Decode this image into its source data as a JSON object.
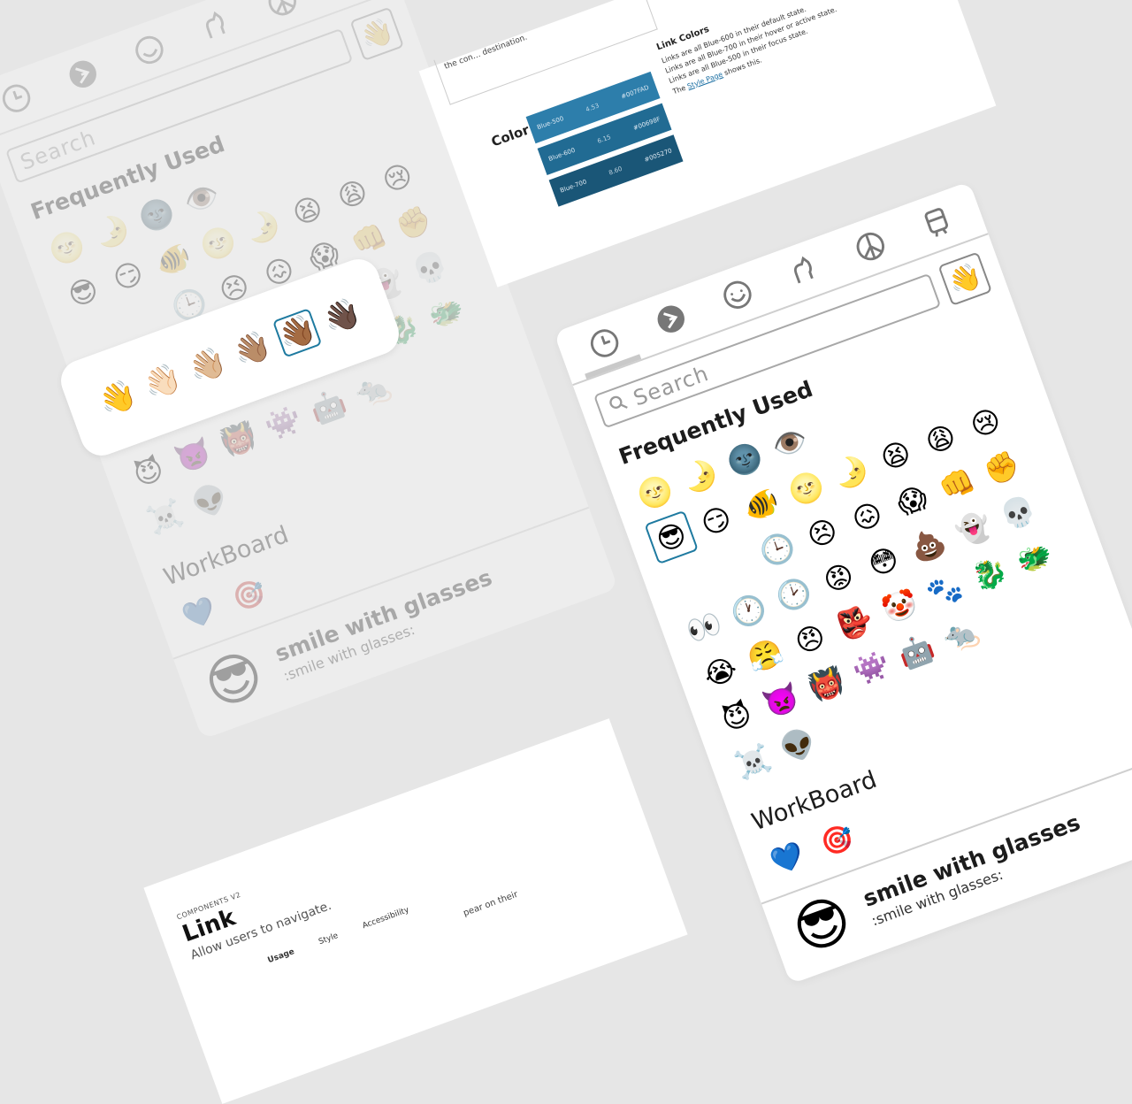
{
  "color_doc": {
    "top_fragment": "the con… destination.",
    "heading": "Color",
    "swatches": [
      {
        "name": "Blue-500",
        "ratio": "4.53",
        "hex": "#007FAD",
        "color": "#2d7eab"
      },
      {
        "name": "Blue-600",
        "ratio": "6.15",
        "hex": "#00698F",
        "color": "#216b93"
      },
      {
        "name": "Blue-700",
        "ratio": "8.60",
        "hex": "#005270",
        "color": "#1a5677"
      }
    ],
    "link_colors": {
      "title": "Link Colors",
      "line1": "Links are all Blue-600 in their default state.",
      "line2": "Links are all Blue-700 in their hover or active state.",
      "line3": "Links are all Blue-500 in their focus state.",
      "line4_pre": "The",
      "line4_link": "Style Page",
      "line4_post": "shows this."
    }
  },
  "link_doc": {
    "overline": "COMPONENTS V2",
    "title": "Link",
    "subtitle": "Allow users to navigate.",
    "tabs": [
      "Usage",
      "Style",
      "Accessibility"
    ],
    "fragment": "pear on their"
  },
  "tone_popup": {
    "tones": [
      "👋",
      "👋🏻",
      "👋🏼",
      "👋🏽",
      "👋🏾",
      "👋🏿"
    ],
    "selected_index": 4
  },
  "picker": {
    "category_icons": [
      "clock-icon",
      "brand-b-icon",
      "smiley-icon",
      "animal-icon",
      "peace-icon",
      "train-icon"
    ],
    "active_category": 0,
    "search_placeholder": "Search",
    "tone_button": "👋",
    "section_title": "Frequently Used",
    "emojis": [
      "🌝",
      "🌛",
      "🌚",
      "👁️",
      "",
      "",
      "",
      "",
      "",
      "😎",
      "😏",
      "🐠",
      "🌝",
      "🌛",
      "😫",
      "😩",
      "😢",
      "",
      "",
      "",
      "🕒",
      "😣",
      "😖",
      "😱",
      "👊",
      "✊",
      "",
      "👀",
      "🕐",
      "🕑",
      "😡",
      "😳",
      "💩",
      "👻",
      "💀",
      "",
      "😭",
      "😤",
      "😠",
      "👺",
      "🤡",
      "🐾",
      "🐉",
      "🐲",
      "",
      "😈",
      "👿",
      "👹",
      "👾",
      "🤖",
      "🐀",
      "",
      "",
      "",
      "☠️",
      "👽",
      "",
      "",
      "",
      "",
      "",
      "",
      ""
    ],
    "selected_emoji_index": 9,
    "workboard_title": "WorkBoard",
    "workboard_emojis": [
      "💙",
      "🎯"
    ],
    "preview": {
      "emoji": "😎",
      "name": "smile with glasses",
      "code": ":smile with glasses:"
    }
  },
  "faded_picker": {
    "search_placeholder": "Search",
    "section_title": "Frequently Used",
    "workboard_title": "WorkBoard",
    "tone_button": "👋",
    "preview_emoji": "😎",
    "preview_name": "smile with glasses",
    "preview_code": ":smile with glasses:"
  }
}
